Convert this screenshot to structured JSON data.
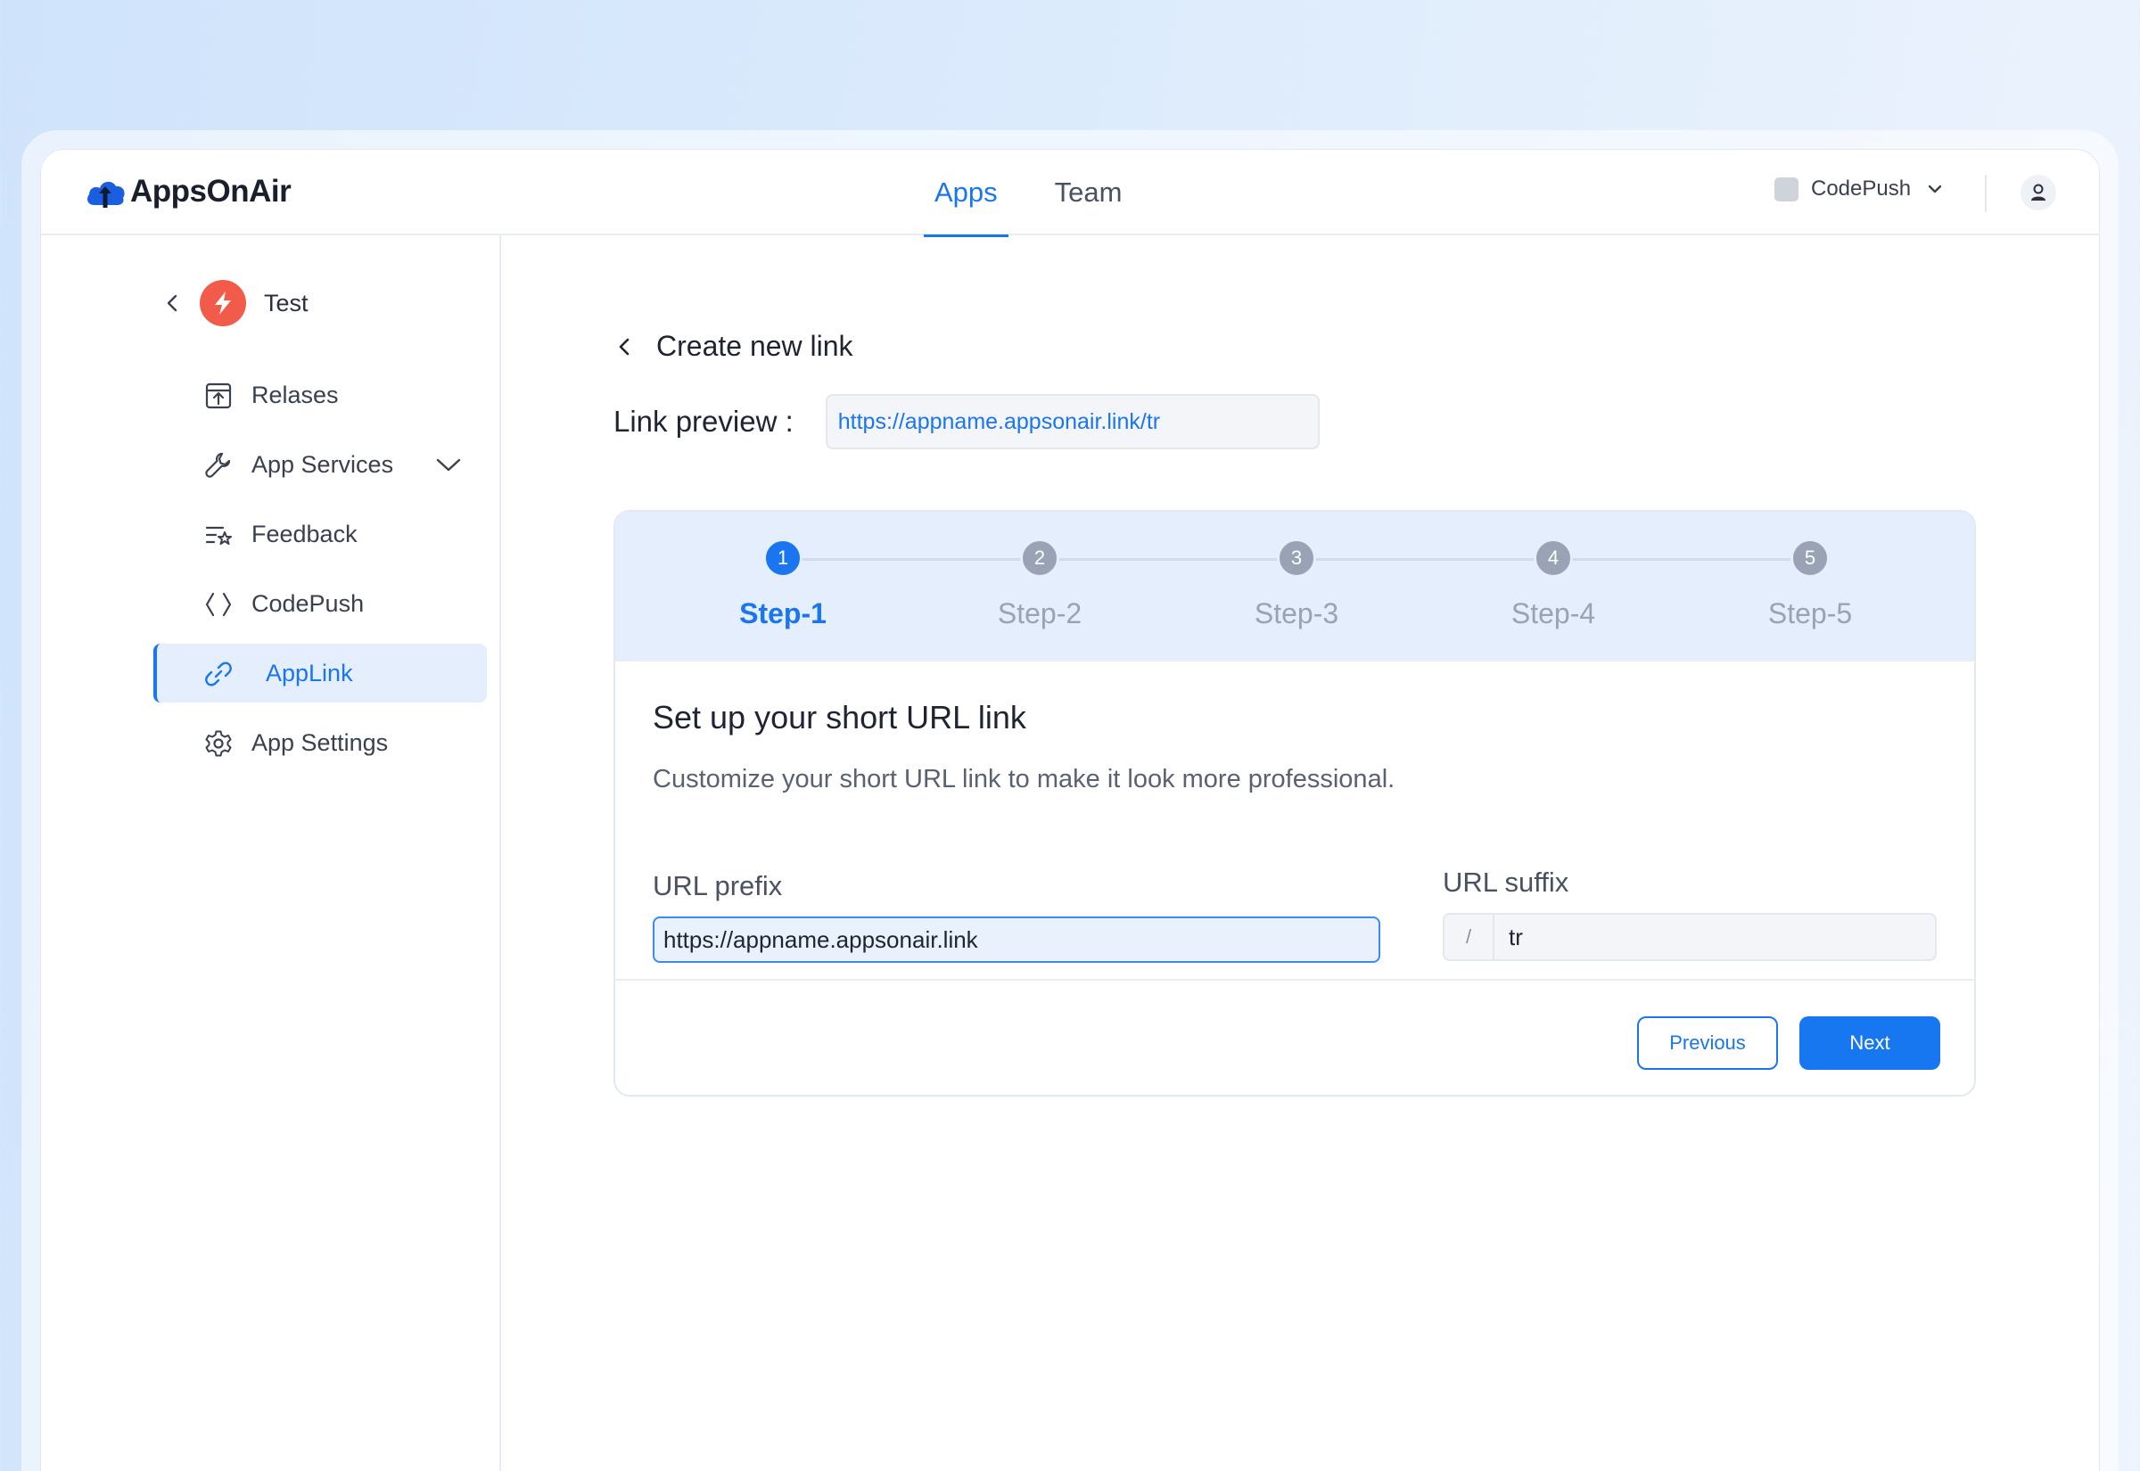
{
  "brand": {
    "name": "AppsOnAir",
    "accent": "#1976f0"
  },
  "nav": {
    "tabs": [
      {
        "label": "Apps",
        "active": true
      },
      {
        "label": "Team",
        "active": false
      }
    ]
  },
  "workspace": {
    "label": "CodePush",
    "icon": "chevron-down-icon"
  },
  "sidebar": {
    "app_name": "Test",
    "items": [
      {
        "label": "Relases",
        "icon": "archive-upload-icon"
      },
      {
        "label": "App Services",
        "icon": "wrench-icon"
      },
      {
        "label": "Feedback",
        "icon": "feedback-star-icon"
      },
      {
        "label": "CodePush",
        "icon": "code-brackets-icon"
      },
      {
        "label": "AppLink",
        "icon": "link-icon",
        "active": true
      },
      {
        "label": "App Settings",
        "icon": "gear-icon"
      }
    ]
  },
  "main": {
    "title": "Create new link",
    "preview_label": "Link preview :",
    "preview_value": "https://appname.appsonair.link/tr"
  },
  "wizard": {
    "steps": [
      {
        "number": "1",
        "label": "Step-1",
        "active": true
      },
      {
        "number": "2",
        "label": "Step-2",
        "active": false
      },
      {
        "number": "3",
        "label": "Step-3",
        "active": false
      },
      {
        "number": "4",
        "label": "Step-4",
        "active": false
      },
      {
        "number": "5",
        "label": "Step-5",
        "active": false
      }
    ],
    "title": "Set up your short URL link",
    "description": "Customize your short URL link to make it look more professional.",
    "prefix_label": "URL prefix",
    "prefix_value": "https://appname.appsonair.link",
    "suffix_label": "URL suffix",
    "suffix_separator": "/",
    "suffix_value": "tr",
    "previous_label": "Previous",
    "next_label": "Next"
  }
}
